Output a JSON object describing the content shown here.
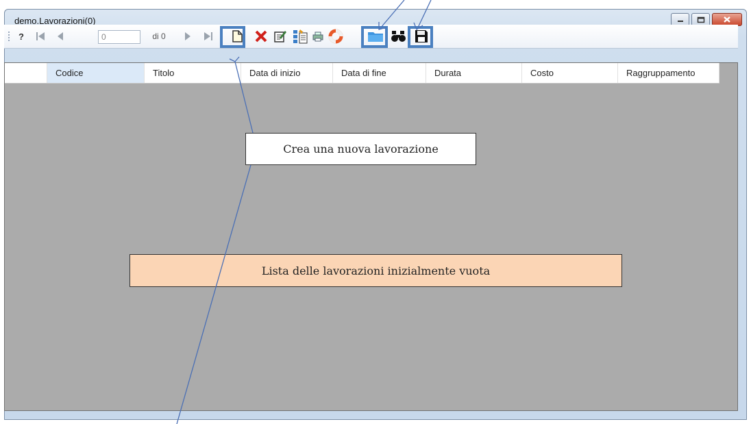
{
  "window": {
    "title": "demo.Lavorazioni(0)"
  },
  "toolbar": {
    "help_label": "?",
    "page_value": "0",
    "page_of_label": "di 0",
    "icons": [
      "help-icon",
      "first-record-icon",
      "previous-record-icon",
      "next-record-icon",
      "last-record-icon",
      "new-document-icon",
      "delete-icon",
      "edit-icon",
      "export-icon",
      "print-icon",
      "lifebuoy-icon",
      "folder-icon",
      "binoculars-icon",
      "save-icon"
    ]
  },
  "grid": {
    "columns": [
      "Codice",
      "Titolo",
      "Data di inizio",
      "Data di fine",
      "Durata",
      "Costo",
      "Raggruppamento"
    ],
    "rows": []
  },
  "annotations": {
    "new_item": "Crea una nuova lavorazione",
    "empty_list": "Lista delle lavorazioni inizialmente vuota"
  },
  "colors": {
    "highlight": "#4a80c0",
    "grid_background": "#ababab",
    "callout_orange": "#fbd5b5",
    "arrow": "#4a6fb5"
  }
}
